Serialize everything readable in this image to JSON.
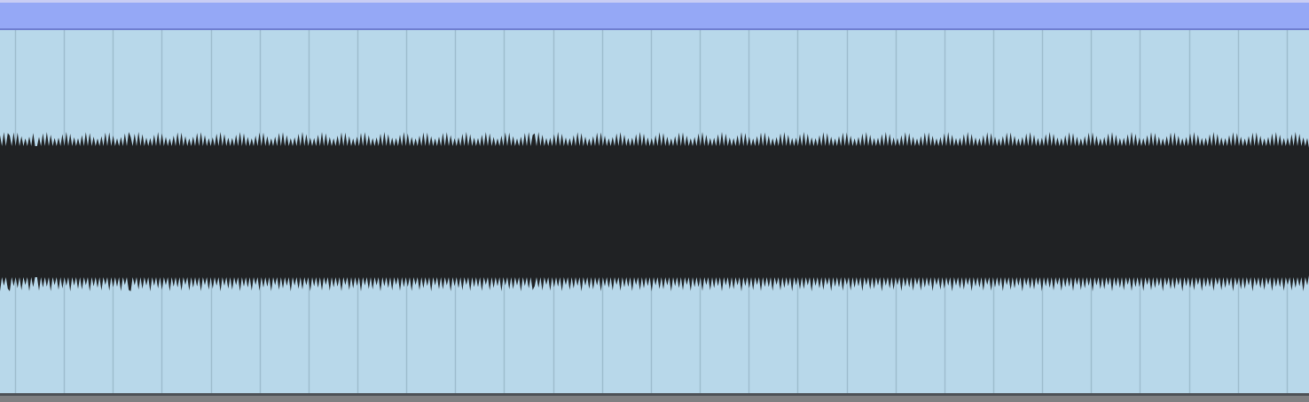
{
  "clip": {
    "header_color": "#95a8f6",
    "body_color": "#b8d8ea",
    "waveform_color": "#202224",
    "grid_color": "#9dbccd",
    "bottom_bar_color": "#7f8082"
  },
  "waveform": {
    "type": "dense-audio",
    "amplitude": 0.44
  }
}
